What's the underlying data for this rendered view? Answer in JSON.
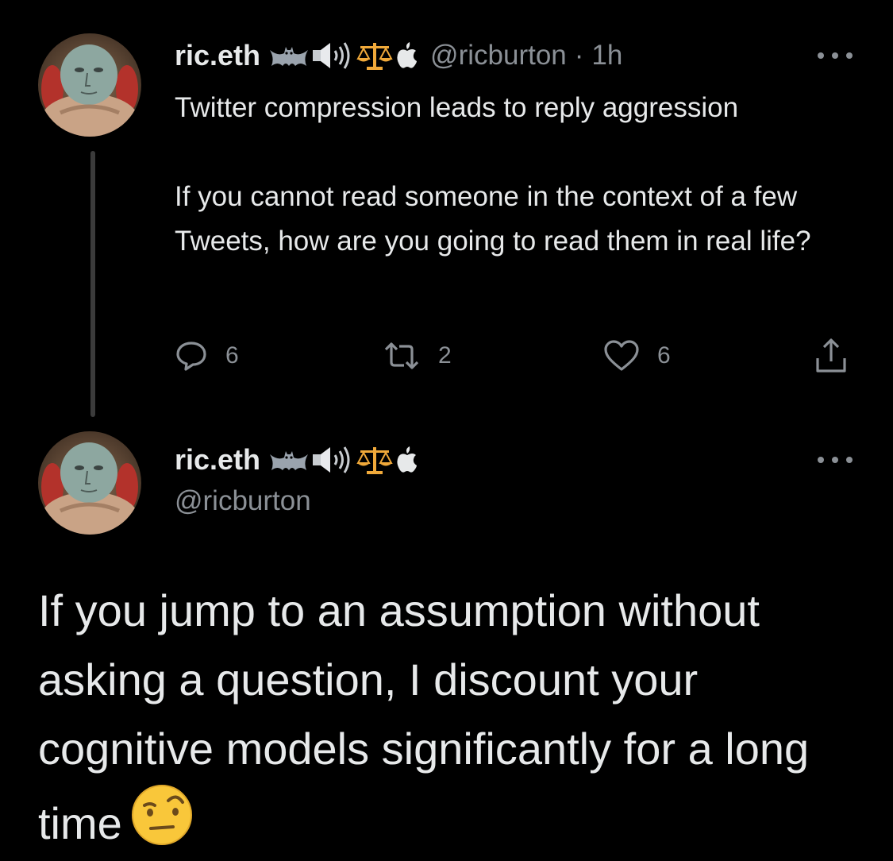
{
  "parent_tweet": {
    "display_name": "ric.eth",
    "handle": "@ricburton",
    "separator": "·",
    "time": "1h",
    "text_line_1": "Twitter compression leads to reply aggression",
    "text_para_2": "If you cannot read someone in the context of a few Tweets, how are you going to read them in real life?",
    "reply_count": "6",
    "retweet_count": "2",
    "like_count": "6",
    "icons": [
      "reply-icon",
      "retweet-icon",
      "like-icon",
      "share-icon",
      "more-icon"
    ]
  },
  "main_tweet": {
    "display_name": "ric.eth",
    "handle": "@ricburton",
    "text": "If you jump to an assumption without asking a question, I discount your cognitive models significantly for a long time",
    "emoji": "face-with-raised-eyebrow"
  },
  "name_badges": [
    "bat",
    "speaker-high-volume",
    "balance-scale",
    "apple"
  ],
  "colors": {
    "background": "#000000",
    "primary_text": "#e7e9ea",
    "secondary_text": "#8b9096",
    "thread_line": "#3b3b3b",
    "scale_gold": "#f0a93a"
  }
}
